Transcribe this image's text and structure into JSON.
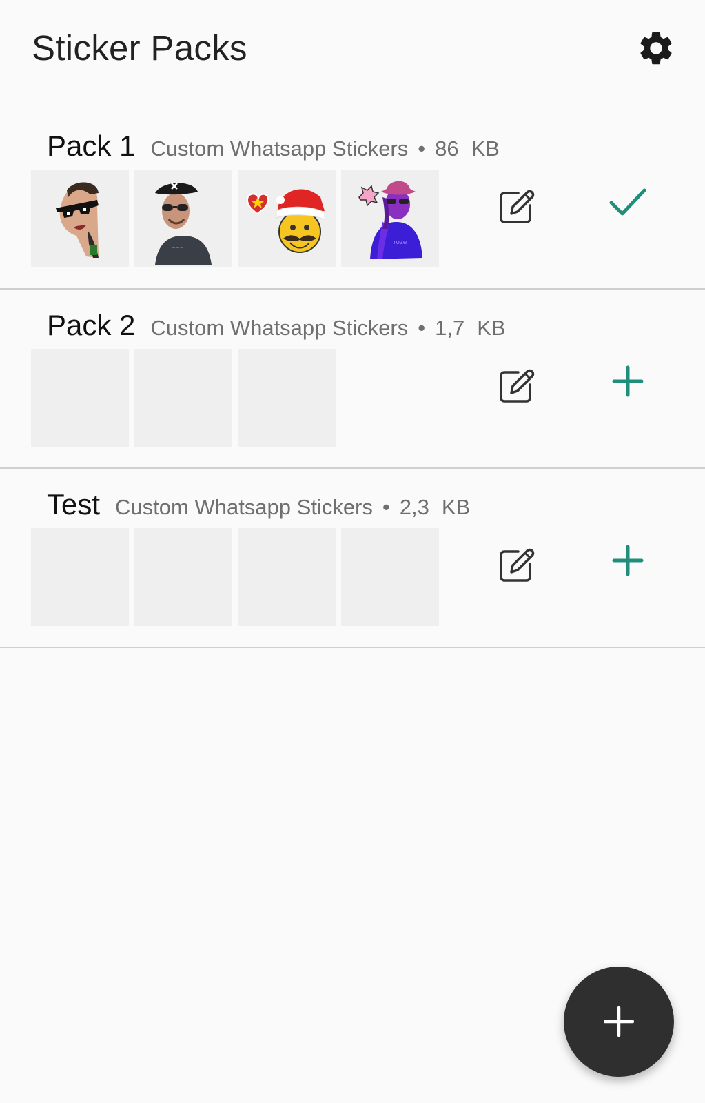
{
  "app": {
    "title": "Sticker Packs"
  },
  "colors": {
    "accent": "#1f8f7c",
    "fab": "#2f2f2f",
    "thumb_bg": "#efefef",
    "divider": "#cfcfcf"
  },
  "icons": {
    "settings": "gear-icon",
    "edit": "edit-icon",
    "added": "check-icon",
    "add": "plus-icon",
    "fab": "plus-icon"
  },
  "packs": [
    {
      "name": "Pack 1",
      "publisher": "Custom Whatsapp Stickers",
      "separator": "•",
      "size": "86",
      "size_unit": "KB",
      "status": "added",
      "stickers": [
        "sunglasses-man",
        "pirate-man",
        "christmas-emoji",
        "purple-cowgirl"
      ]
    },
    {
      "name": "Pack 2",
      "publisher": "Custom Whatsapp Stickers",
      "separator": "•",
      "size": "1,7",
      "size_unit": "KB",
      "status": "add",
      "stickers": [
        "empty",
        "empty",
        "empty"
      ]
    },
    {
      "name": "Test",
      "publisher": "Custom Whatsapp Stickers",
      "separator": "•",
      "size": "2,3",
      "size_unit": "KB",
      "status": "add",
      "stickers": [
        "empty",
        "empty",
        "empty",
        "empty"
      ]
    }
  ]
}
